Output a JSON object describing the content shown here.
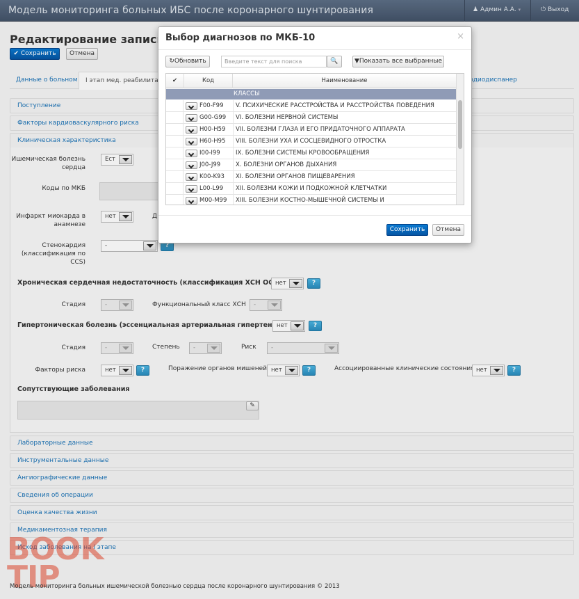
{
  "app": {
    "title": "Модель мониторинга больных ИБС после коронарного шунтирования",
    "user": "Админ А.А.",
    "logout": "Выход"
  },
  "page": {
    "title": "Редактирование записи Р",
    "save": "Сохранить",
    "cancel": "Отмена"
  },
  "tabs": [
    {
      "label": "Данные о больном"
    },
    {
      "label": "I этап мед. реабилитаци"
    },
    {
      "label": "рдиодиспанер"
    }
  ],
  "sections": {
    "admission": "Поступление",
    "risk_factors": "Факторы кардиоваскулярного риска",
    "clinical": "Клиническая характеристика",
    "lab": "Лабораторные данные",
    "instrumental": "Инструментальные данные",
    "angiographic": "Ангиографические данные",
    "operation": "Сведения об операции",
    "quality": "Оценка качества жизни",
    "drugs": "Медикаментозная терапия",
    "outcome": "Исход заболевания на I этапе"
  },
  "form": {
    "ischemic_label": "Ишемическая болезнь сердца",
    "ischemic_value": "Ест",
    "mkb_label": "Коды по МКБ",
    "infarct_label": "Инфаркт миокарда в анамнезе",
    "infarct_value": "нет",
    "infarct_d": "Д",
    "angina_label": "Стенокардия (классификация по CCS)",
    "angina_value": "-",
    "chf_title": "Хроническая сердечная недостаточность (классификация ХСН ОССН)",
    "chf_value": "нет",
    "chf_stage_label": "Стадия",
    "chf_stage_value": "-",
    "chf_class_label": "Функциональный класс ХСН",
    "chf_class_value": "-",
    "htn_title": "Гипертоническая болезнь (эссенциальная артериальная гипертензия)",
    "htn_value": "нет",
    "htn_stage_label": "Стадия",
    "htn_stage_value": "-",
    "htn_degree_label": "Степень",
    "htn_degree_value": "-",
    "htn_risk_label": "Риск",
    "htn_risk_value": "-",
    "rf_label": "Факторы риска",
    "rf_value": "нет",
    "organs_label": "Поражение органов мишеней",
    "organs_value": "нет",
    "assoc_label": "Ассоциированные клинические состояния",
    "assoc_value": "нет",
    "comorbid_title": "Сопутствующие заболевания",
    "help": "?"
  },
  "modal": {
    "title": "Выбор диагнозов по МКБ-10",
    "close": "×",
    "refresh": "Обновить",
    "search_placeholder": "Введите текст для поиска",
    "show_selected": "Показать все выбранные",
    "col_code": "Код",
    "col_name": "Наименование",
    "group": "КЛАССЫ",
    "rows": [
      {
        "code": "F00-F99",
        "name": "V. ПСИХИЧЕСКИЕ РАССТРОЙСТВА И РАССТРОЙСТВА ПОВЕДЕНИЯ"
      },
      {
        "code": "G00-G99",
        "name": "VI. БОЛЕЗНИ НЕРВНОЙ СИСТЕМЫ"
      },
      {
        "code": "H00-H59",
        "name": "VII. БОЛЕЗНИ ГЛАЗА И ЕГО ПРИДАТОЧНОГО АППАРАТА"
      },
      {
        "code": "H60-H95",
        "name": "VIII. БОЛЕЗНИ УХА И СОСЦЕВИДНОГО ОТРОСТКА"
      },
      {
        "code": "I00-I99",
        "name": "IX. БОЛЕЗНИ СИСТЕМЫ КРОВООБРАЩЕНИЯ"
      },
      {
        "code": "J00-J99",
        "name": "X. БОЛЕЗНИ ОРГАНОВ ДЫХАНИЯ"
      },
      {
        "code": "K00-K93",
        "name": "XI. БОЛЕЗНИ ОРГАНОВ ПИЩЕВАРЕНИЯ"
      },
      {
        "code": "L00-L99",
        "name": "XII. БОЛЕЗНИ КОЖИ И ПОДКОЖНОЙ КЛЕТЧАТКИ"
      },
      {
        "code": "M00-M99",
        "name": "XIII. БОЛЕЗНИ КОСТНО-МЫШЕЧНОЙ СИСТЕМЫ И"
      }
    ],
    "save": "Сохранить",
    "cancel": "Отмена"
  },
  "watermark": "BOOK TIP",
  "footer": "Модель мониторинга больных ишемической болезнью сердца после коронарного шунтирования © 2013"
}
